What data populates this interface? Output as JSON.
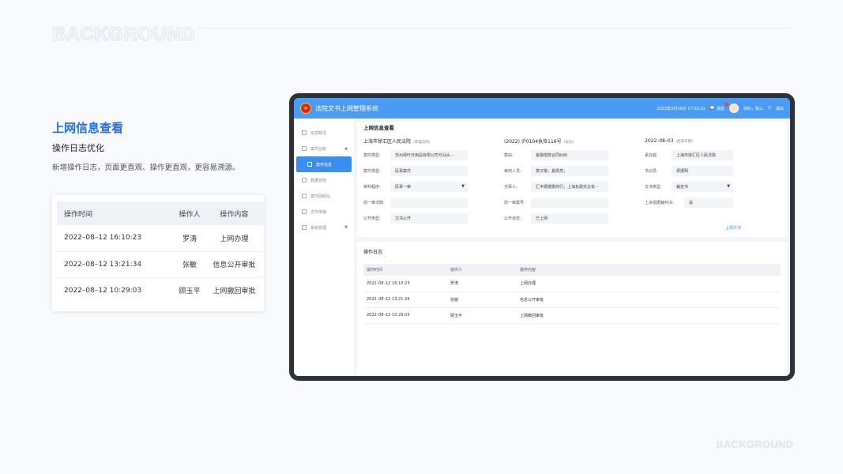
{
  "bg_word": "BACKGROUND",
  "title": "上网信息查看",
  "subtitle": "操作日志优化",
  "description": "新增操作日志，页面更直观、操作更直观，更容易溯源。",
  "card": {
    "headers": [
      "操作时间",
      "操作人",
      "操作内容"
    ],
    "rows": [
      {
        "time": "2022–08–12    16:10:23",
        "user": "罗涛",
        "action": "上网办理"
      },
      {
        "time": "2022–08–12    13:21:34",
        "user": "张敏",
        "action": "信息公开审批"
      },
      {
        "time": "2022–08–12    10:29:03",
        "user": "顾玉平",
        "action": "上网撤回审批"
      }
    ]
  },
  "app": {
    "title": "法院文书上网管理系统",
    "datetime": "2022年3月19日 17:02:21",
    "notify": "消息",
    "greeting": "你好，张三",
    "logout": "退出",
    "sidebar": [
      {
        "label": "信息概况"
      },
      {
        "label": "案件台账"
      },
      {
        "label": "案件信息"
      },
      {
        "label": "数据自检"
      },
      {
        "label": "案件回收站"
      },
      {
        "label": "文件传输"
      },
      {
        "label": "系统管理"
      }
    ],
    "info": {
      "section_title": "上网信息查看",
      "court": "上海市徐汇区人民法院",
      "court_note": "(审理法院)",
      "case_no": "(2022) 沪0104执恢116号",
      "case_no_note": "(案号)",
      "date": "2022–08–03",
      "date_note": "(结案日期)",
      "fields": [
        [
          {
            "label": "案件类型:",
            "value": "苏州绿叶日用品有限公司与汕头···",
            "dropdown": false
          },
          {
            "label": "案由:",
            "value": "金融借款合同纠纷",
            "dropdown": false
          },
          {
            "label": "承办庭:",
            "value": "上海市徐汇区人民法院",
            "dropdown": false
          }
        ],
        [
          {
            "label": "案件类型:",
            "value": "民事案件",
            "dropdown": false
          },
          {
            "label": "审判人员:",
            "value": "萧子敬；夏侯亮；",
            "dropdown": false
          },
          {
            "label": "书记员:",
            "value": "侯振明",
            "dropdown": false
          }
        ],
        [
          {
            "label": "审判程序:",
            "value": "民事一审",
            "dropdown": true
          },
          {
            "label": "当事人:",
            "value": "汇丰顺德惠商行；上海友晨实业有···",
            "dropdown": false
          },
          {
            "label": "文书类型:",
            "value": "裁定书",
            "dropdown": true
          }
        ],
        [
          {
            "label": "前一审法院:",
            "value": "",
            "dropdown": false
          },
          {
            "label": "前一审案号:",
            "value": "",
            "dropdown": false
          },
          {
            "label": "上诉视据裁判决:",
            "value": "是",
            "dropdown": false
          }
        ],
        [
          {
            "label": "公开类型:",
            "value": "文书公开",
            "dropdown": false
          },
          {
            "label": "公开状态:",
            "value": "已上网",
            "dropdown": false
          },
          {
            "label": "",
            "value": "",
            "dropdown": false
          }
        ]
      ],
      "link": "上网文书"
    },
    "log": {
      "title": "操作日志",
      "headers": [
        "操作时间",
        "操作人",
        "操作内容"
      ],
      "rows": [
        {
          "time": "2022–08–12    16:10:23",
          "user": "罗涛",
          "action": "上网办理"
        },
        {
          "time": "2022–08–12    13:21:34",
          "user": "张敏",
          "action": "信息公开审批"
        },
        {
          "time": "2022–08–12    10:29:03",
          "user": "顾玉平",
          "action": "上网撤回审批"
        }
      ]
    }
  }
}
